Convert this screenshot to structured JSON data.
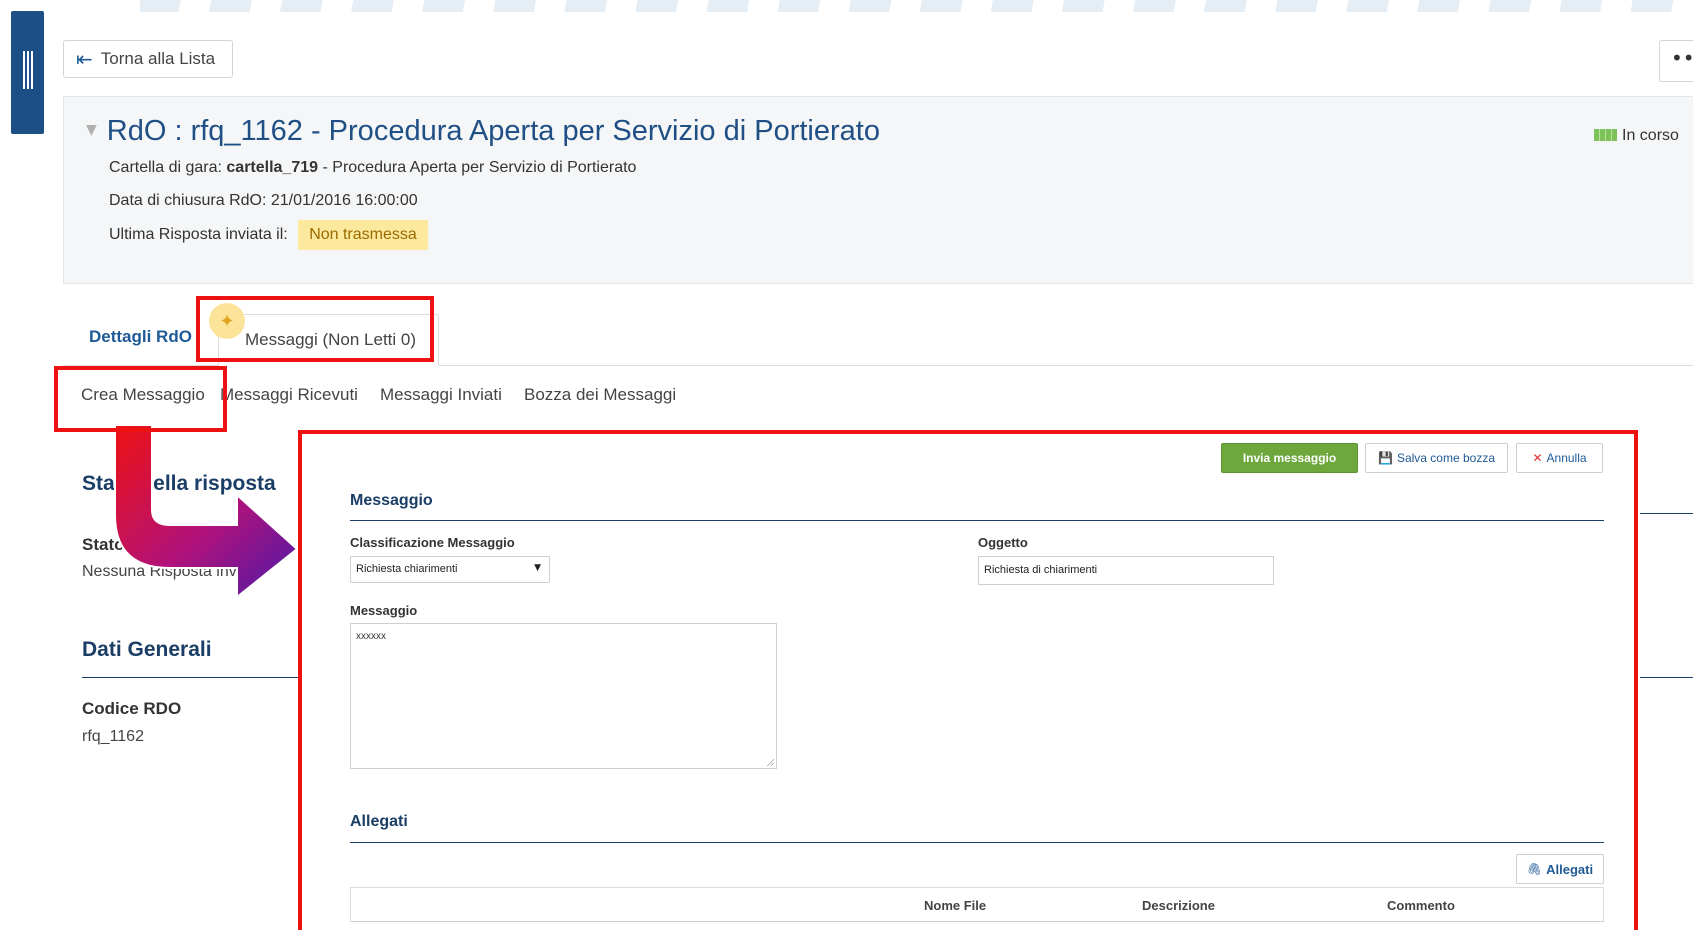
{
  "nav": {
    "back_label": "Torna alla Lista",
    "more_label": "•••"
  },
  "header": {
    "title": "RdO : rfq_1162 - Procedura Aperta per Servizio di Portierato",
    "status": "In corso",
    "cartella_label": "Cartella di gara:",
    "cartella_value": "cartella_719",
    "cartella_desc": " - Procedura Aperta per Servizio di Portierato",
    "data_chiusura": "Data di chiusura RdO: 21/01/2016 16:00:00",
    "ultima_risposta_label": "Ultima Risposta inviata il:",
    "ultima_risposta_value": "Non trasmessa"
  },
  "tabs": {
    "dettagli": "Dettagli RdO",
    "messaggi": "Messaggi (Non Letti 0)"
  },
  "subtabs": [
    "Crea Messaggio",
    "Messaggi Ricevuti",
    "Messaggi Inviati",
    "Bozza dei Messaggi"
  ],
  "left": {
    "stato_title": "Stato della risposta",
    "stato_label": "Stato della",
    "stato_value": "Nessuna Risposta inviata",
    "dati_title": "Dati Generali",
    "codice_label": "Codice RDO",
    "codice_value": "rfq_1162"
  },
  "form": {
    "buttons": {
      "send": "Invia messaggio",
      "draft": "Salva come bozza",
      "cancel": "Annulla"
    },
    "section_message": "Messaggio",
    "classificazione_label": "Classificazione Messaggio",
    "classificazione_value": "Richiesta chiarimenti",
    "oggetto_label": "Oggetto",
    "oggetto_value": "Richiesta di chiarimenti",
    "messaggio_label": "Messaggio",
    "messaggio_value": "xxxxxx",
    "section_allegati": "Allegati",
    "allegati_button": "Allegati",
    "table_columns": [
      "Nome File",
      "Descrizione",
      "Commento"
    ]
  },
  "colors": {
    "primary_blue": "#1f5a96",
    "heading_navy": "#1b3e66",
    "success_green": "#6ea73c",
    "highlight_red": "#ee1111",
    "warning_yellow": "#fce99e"
  }
}
